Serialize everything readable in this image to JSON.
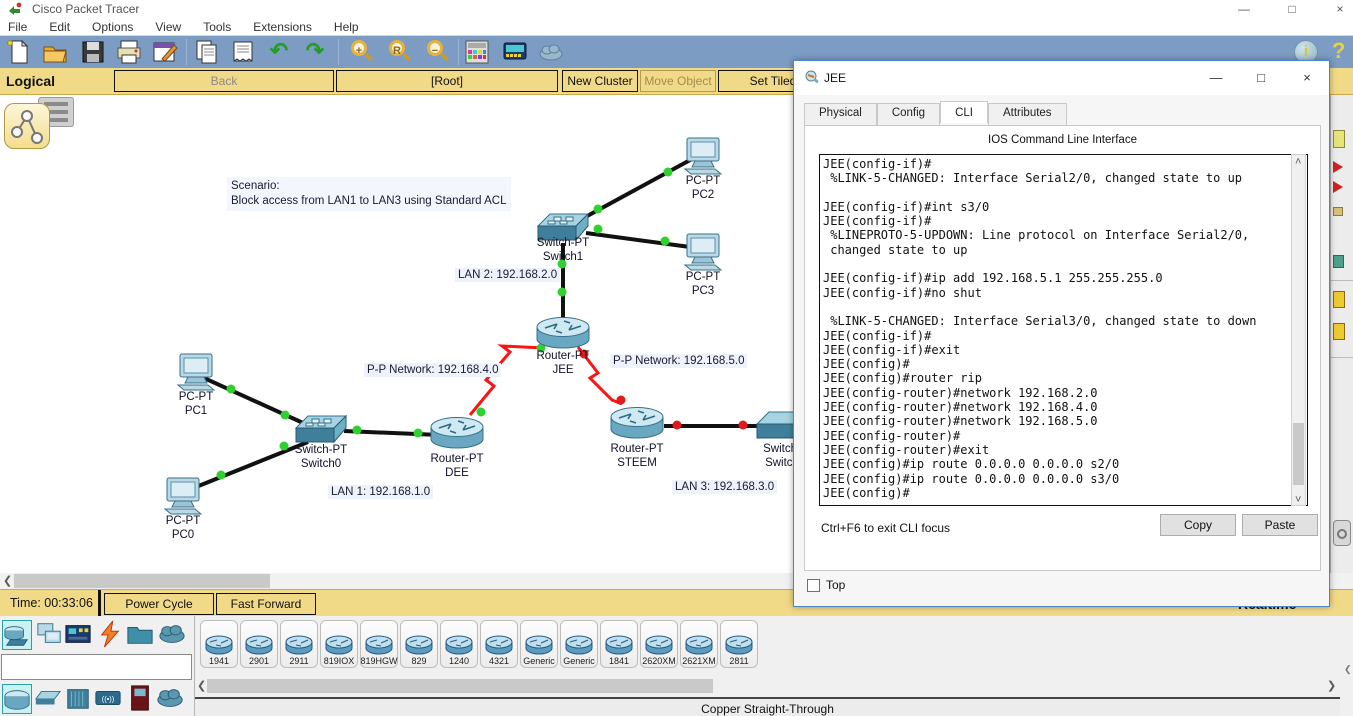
{
  "window": {
    "title": "Cisco Packet Tracer"
  },
  "icons": {
    "minimize": "—",
    "maximize": "□",
    "close": "×",
    "undo": "↶",
    "redo": "↷",
    "zoom_in": "+",
    "zoom_reset": "R",
    "zoom_out": "−",
    "info": "i",
    "help": "?",
    "scroll_left": "❮",
    "scroll_right": "❯",
    "scroll_up": "˄",
    "scroll_down": "˅"
  },
  "menu": {
    "items": [
      "File",
      "Edit",
      "Options",
      "View",
      "Tools",
      "Extensions",
      "Help"
    ]
  },
  "viewbar": {
    "mode": "Logical",
    "back": "Back",
    "root": "[Root]",
    "new_cluster": "New Cluster",
    "move_object": "Move Object",
    "set_tiled": "Set Tiled"
  },
  "scenario": {
    "line1": "Scenario:",
    "line2": "Block access from LAN1 to LAN3 using Standard ACL"
  },
  "topology": {
    "devices": [
      {
        "model": "PC-PT",
        "name": "PC1"
      },
      {
        "model": "PC-PT",
        "name": "PC0"
      },
      {
        "model": "Switch-PT",
        "name": "Switch0"
      },
      {
        "model": "Router-PT",
        "name": "DEE"
      },
      {
        "model": "Switch-PT",
        "name": "Switch1"
      },
      {
        "model": "PC-PT",
        "name": "PC2"
      },
      {
        "model": "PC-PT",
        "name": "PC3"
      },
      {
        "model": "Router-PT",
        "name": "JEE"
      },
      {
        "model": "Router-PT",
        "name": "STEEM"
      },
      {
        "model": "Switch-",
        "name": "Switch"
      }
    ],
    "labels": [
      "P-P Network: 192.168.4.0",
      "LAN 1: 192.168.1.0",
      "LAN 2: 192.168.2.0",
      "P-P Network: 192.168.5.0",
      "LAN 3: 192.168.3.0"
    ],
    "link_up_color": "#2fd12f",
    "link_down_color": "#e01b1b",
    "serial_link_color": "#ff1212"
  },
  "dialog": {
    "title": "JEE",
    "tabs": [
      "Physical",
      "Config",
      "CLI",
      "Attributes"
    ],
    "active_tab": "CLI",
    "cli_header": "IOS Command Line Interface",
    "terminal_lines": [
      "JEE(config-if)#",
      " %LINK-5-CHANGED: Interface Serial2/0, changed state to up",
      "",
      "JEE(config-if)#int s3/0",
      "JEE(config-if)#",
      " %LINEPROTO-5-UPDOWN: Line protocol on Interface Serial2/0,",
      " changed state to up",
      "",
      "JEE(config-if)#ip add 192.168.5.1 255.255.255.0",
      "JEE(config-if)#no shut",
      "",
      " %LINK-5-CHANGED: Interface Serial3/0, changed state to down",
      "JEE(config-if)#",
      "JEE(config-if)#exit",
      "JEE(config)#",
      "JEE(config)#router rip",
      "JEE(config-router)#network 192.168.2.0",
      "JEE(config-router)#network 192.168.4.0",
      "JEE(config-router)#network 192.168.5.0",
      "JEE(config-router)#",
      "JEE(config-router)#exit",
      "JEE(config)#ip route 0.0.0.0 0.0.0.0 s2/0",
      "JEE(config)#ip route 0.0.0.0 0.0.0.0 s3/0",
      "JEE(config)#"
    ],
    "hint": "Ctrl+F6 to exit CLI focus",
    "copy": "Copy",
    "paste": "Paste",
    "top": "Top"
  },
  "timebar": {
    "time": "Time: 00:33:06",
    "power_cycle": "Power Cycle Devices",
    "fast_forward": "Fast Forward Time",
    "realtime": "Realtime"
  },
  "palette": {
    "models": [
      "1941",
      "2901",
      "2911",
      "819IOX",
      "819HGW",
      "829",
      "1240",
      "4321",
      "Generic",
      "Generic",
      "1841",
      "2620XM",
      "2621XM",
      "2811"
    ]
  },
  "statusbar": {
    "connection": "Copper Straight-Through"
  }
}
